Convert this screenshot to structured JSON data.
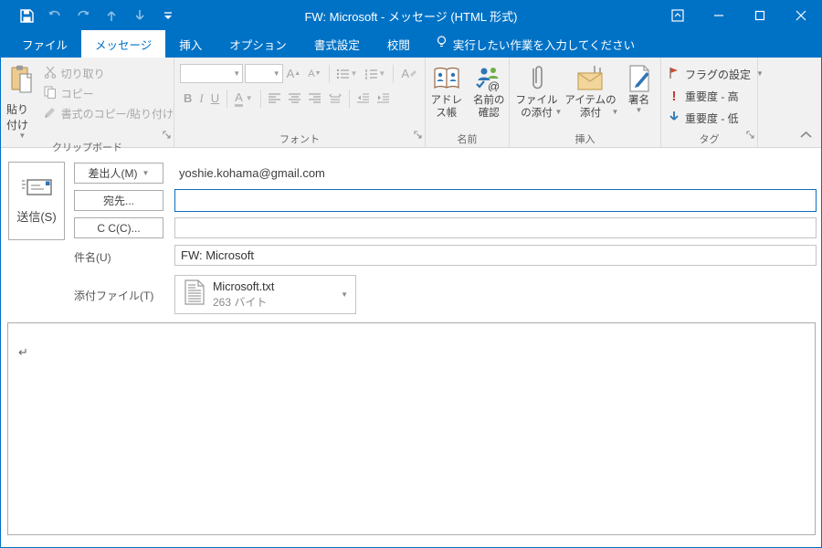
{
  "window": {
    "title": "FW: Microsoft - メッセージ (HTML 形式)"
  },
  "tabs": [
    {
      "label": "ファイル"
    },
    {
      "label": "メッセージ"
    },
    {
      "label": "挿入"
    },
    {
      "label": "オプション"
    },
    {
      "label": "書式設定"
    },
    {
      "label": "校閲"
    }
  ],
  "tellme": {
    "label": "実行したい作業を入力してください"
  },
  "ribbon": {
    "clipboard": {
      "group_label": "クリップボード",
      "paste": "貼り付け",
      "cut": "切り取り",
      "copy": "コピー",
      "format_painter": "書式のコピー/貼り付け"
    },
    "font": {
      "group_label": "フォント",
      "bold": "B",
      "italic": "I",
      "underline": "U",
      "font_color": "A",
      "grow": "A",
      "shrink": "A"
    },
    "names": {
      "group_label": "名前",
      "address_book": "アドレス帳",
      "check_names": "名前の確認"
    },
    "include": {
      "group_label": "挿入",
      "attach_file": "ファイルの添付",
      "attach_item": "アイテムの添付",
      "signature": "署名"
    },
    "tags": {
      "group_label": "タグ",
      "follow_up": "フラグの設定",
      "high_importance": "重要度 - 高",
      "low_importance": "重要度 - 低"
    }
  },
  "form": {
    "send_label": "送信(S)",
    "from_button": "差出人(M)",
    "from_value": "yoshie.kohama@gmail.com",
    "to_button": "宛先...",
    "to_value": "",
    "cc_button": "C C(C)...",
    "cc_value": "",
    "subject_label": "件名(U)",
    "subject_value": "FW: Microsoft",
    "attachment_label": "添付ファイル(T)",
    "attachment": {
      "name": "Microsoft.txt",
      "size": "263 バイト"
    }
  },
  "body": {
    "mark": "↵"
  },
  "colors": {
    "titlebar_blue": "#0072c6",
    "ribbon_bg": "#f1f1f1",
    "focus_border": "#0e6dbd",
    "flag_red": "#c94f34",
    "importance_red": "#c0392b",
    "low_arrow_blue": "#2e75b5",
    "attachment_tan": "#f2d59a"
  }
}
